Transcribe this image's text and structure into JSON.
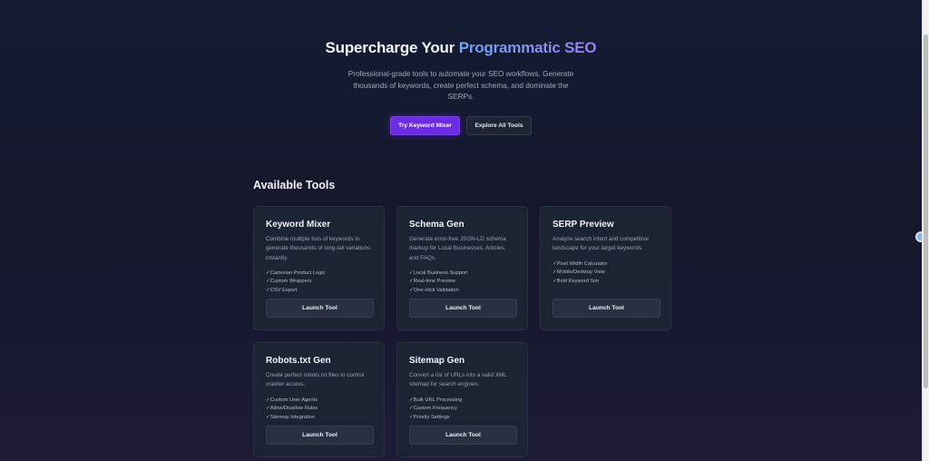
{
  "hero": {
    "title_prefix": "Supercharge Your ",
    "title_accent": "Programmatic SEO",
    "subtitle": "Professional-grade tools to automate your SEO workflows. Generate thousands of keywords, create perfect schema, and dominate the SERPs.",
    "primary_button": "Try Keyword Mixer",
    "secondary_button": "Explore All Tools"
  },
  "section_title": "Available Tools",
  "tools": [
    {
      "name": "Keyword Mixer",
      "description": "Combine multiple lists of keywords to generate thousands of long-tail variations instantly.",
      "features": [
        "✓Cartesian Product Logic",
        "✓Custom Wrappers",
        "✓CSV Export"
      ],
      "button": "Launch Tool"
    },
    {
      "name": "Schema Gen",
      "description": "Generate error-free JSON-LD schema markup for Local Businesses, Articles, and FAQs.",
      "features": [
        "✓Local Business Support",
        "✓Real-time Preview",
        "✓One-click Validation"
      ],
      "button": "Launch Tool"
    },
    {
      "name": "SERP Preview",
      "description": "Analyze search intent and competitive landscape for your target keywords.",
      "features": [
        "✓Pixel Width Calculator",
        "✓Mobile/Desktop View",
        "✓Bold Keyword Sim"
      ],
      "button": "Launch Tool"
    },
    {
      "name": "Robots.txt Gen",
      "description": "Create perfect robots.txt files to control crawler access.",
      "features": [
        "✓Custom User Agents",
        "✓Allow/Disallow Rules",
        "✓Sitemap Integration"
      ],
      "button": "Launch Tool"
    },
    {
      "name": "Sitemap Gen",
      "description": "Convert a list of URLs into a valid XML sitemap for search engines.",
      "features": [
        "✓Bulk URL Processing",
        "✓Custom Frequency",
        "✓Priority Settings"
      ],
      "button": "Launch Tool"
    }
  ]
}
